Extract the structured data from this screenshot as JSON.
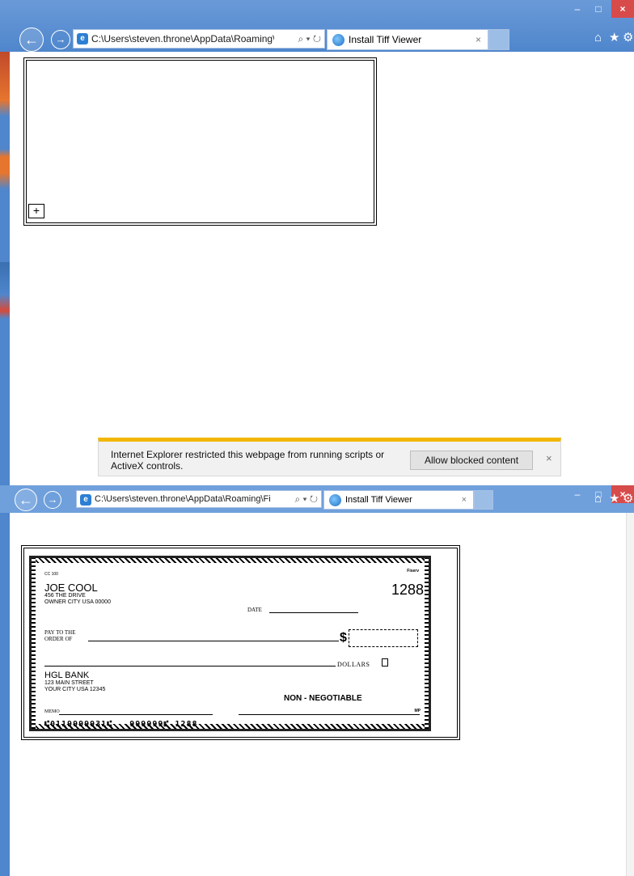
{
  "window1": {
    "address": "C:\\Users\\steven.throne\\AppData\\Roaming\\F",
    "address_controls": "⌕ ▾ ↻",
    "tab_title": "Install Tiff Viewer",
    "tab_close": "×",
    "window_controls": {
      "minimize": "–",
      "maximize": "□",
      "close": "×"
    },
    "placeholder_glyph": "+",
    "notification": {
      "message": "Internet Explorer restricted this webpage from running scripts or ActiveX controls.",
      "button": "Allow blocked content",
      "close": "×"
    }
  },
  "window2": {
    "address": "C:\\Users\\steven.throne\\AppData\\Roaming\\Fiserv\\Alt",
    "address_controls": "⌕ ▾ ↻",
    "tab_title": "Install Tiff Viewer",
    "tab_close": "×",
    "window_controls": {
      "minimize": "–",
      "maximize": "□",
      "close": "×"
    }
  },
  "icons": {
    "back": "←",
    "forward": "→",
    "home": "⌂",
    "favorites": "★",
    "tools": "⚙"
  },
  "check": {
    "cc": "CC 100",
    "fiserv": "Fiserv",
    "name": "JOE COOL",
    "address_line1": "456 THE DRIVE",
    "address_line2": "OWNER CITY USA 00000",
    "number": "1288",
    "date_label": "DATE",
    "pay_to": "PAY TO THE",
    "order_of": "ORDER OF",
    "dollar_sign": "$",
    "dollars_label": "DOLLARS",
    "bank_name": "HGL BANK",
    "bank_address1": "123 MAIN STREET",
    "bank_address2": "YOUR CITY USA 12345",
    "non_negotiable": "NON - NEGOTIABLE",
    "memo_label": "MEMO",
    "mp": "MP",
    "micr": "⑆0119999931⑆   999999⑈ 1288"
  },
  "colors": {
    "chrome": "#5b8fcf",
    "close": "#d74b4b",
    "notif_accent": "#f2b705"
  }
}
